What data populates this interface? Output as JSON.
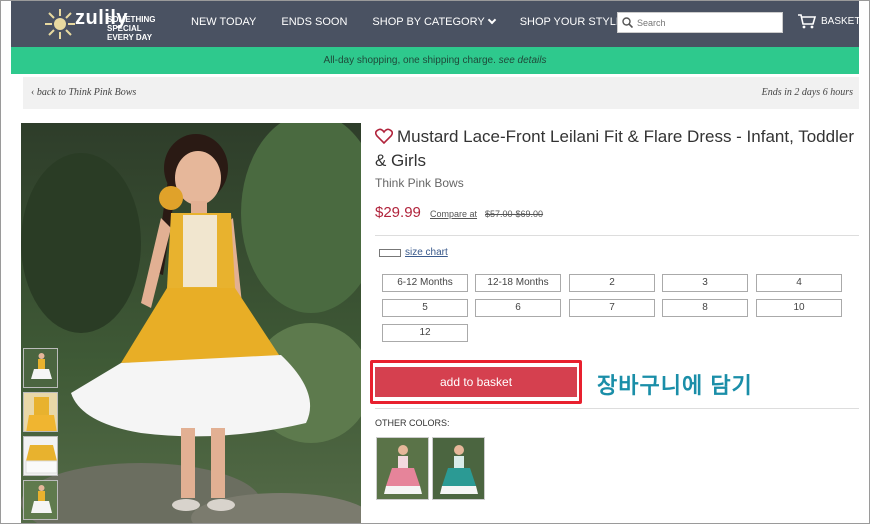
{
  "header": {
    "logo_text": "zulily",
    "tagline": [
      "SOMETHING",
      "SPECIAL",
      "EVERY DAY"
    ],
    "nav": [
      "NEW TODAY",
      "ENDS SOON",
      "SHOP BY CATEGORY",
      "SHOP YOUR STYLE"
    ],
    "search_placeholder": "Search",
    "basket_label": "BASKET"
  },
  "banner": {
    "text": "All-day shopping, one shipping charge.",
    "link": "see details"
  },
  "breadcrumb": {
    "back_label": "back to Think Pink Bows",
    "ends_label": "Ends in 2 days 6 hours"
  },
  "product": {
    "title": "Mustard Lace-Front Leilani Fit & Flare Dress - Infant, Toddler & Girls",
    "brand": "Think Pink Bows",
    "price": "$29.99",
    "compare_label": "Compare at",
    "compare_price": "$57.00-$69.00",
    "size_chart_label": "size chart",
    "sizes": [
      "6-12 Months",
      "12-18 Months",
      "2",
      "3",
      "4",
      "5",
      "6",
      "7",
      "8",
      "10",
      "12"
    ],
    "add_button_label": "add to basket",
    "annotation_korean": "장바구니에 담기",
    "other_colors_label": "OTHER COLORS:"
  },
  "colors": {
    "header_bg": "#4a5262",
    "banner_bg": "#2ec98d",
    "price": "#b1243c",
    "add_button": "#d5404f",
    "highlight_box": "#e8202e",
    "korean_annotation": "#1a8ea8"
  }
}
